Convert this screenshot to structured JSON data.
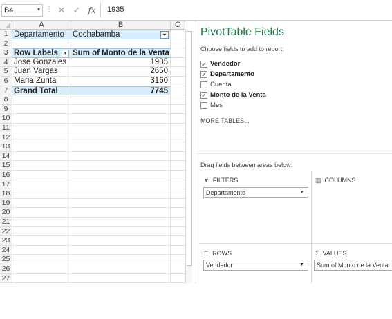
{
  "formula_bar": {
    "name_box": "B4",
    "name_box_arrow": "▾",
    "separator": "⋮",
    "cancel_glyph": "✕",
    "enter_glyph": "✓",
    "fx_label": "fx",
    "value": "1935"
  },
  "sheet": {
    "columns": [
      "A",
      "B",
      "C"
    ],
    "rows": [
      {
        "num": "1",
        "a": "Departamento",
        "b": "Cochabamba"
      },
      {
        "num": "2",
        "a": "",
        "b": ""
      },
      {
        "num": "3",
        "a": "Row Labels",
        "b": "Sum of Monto de la Venta"
      },
      {
        "num": "4",
        "a": "Jose Gonzales",
        "b": "1935"
      },
      {
        "num": "5",
        "a": "Juan Vargas",
        "b": "2650"
      },
      {
        "num": "6",
        "a": "Maria Zurita",
        "b": "3160"
      },
      {
        "num": "7",
        "a": "Grand Total",
        "b": "7745"
      },
      {
        "num": "8"
      },
      {
        "num": "9"
      },
      {
        "num": "10"
      },
      {
        "num": "11"
      },
      {
        "num": "12"
      },
      {
        "num": "13"
      },
      {
        "num": "14"
      },
      {
        "num": "15"
      },
      {
        "num": "16"
      },
      {
        "num": "17"
      },
      {
        "num": "18"
      },
      {
        "num": "19"
      },
      {
        "num": "20"
      },
      {
        "num": "21"
      },
      {
        "num": "22"
      },
      {
        "num": "23"
      },
      {
        "num": "24"
      },
      {
        "num": "25"
      },
      {
        "num": "26"
      },
      {
        "num": "27"
      }
    ]
  },
  "pivot_pane": {
    "title": "PivotTable Fields",
    "subtitle": "Choose fields to add to report:",
    "fields": [
      {
        "label": "Vendedor",
        "checked": true
      },
      {
        "label": "Departamento",
        "checked": true
      },
      {
        "label": "Cuenta",
        "checked": false
      },
      {
        "label": "Monto de la Venta",
        "checked": true
      },
      {
        "label": "Mes",
        "checked": false
      }
    ],
    "more_tables": "MORE TABLES...",
    "drag_hint": "Drag fields between areas below:",
    "areas": {
      "filters": {
        "label": "FILTERS",
        "icon": "filter-icon",
        "chip": "Departamento"
      },
      "columns": {
        "label": "COLUMNS",
        "icon": "columns-icon"
      },
      "rows": {
        "label": "ROWS",
        "icon": "rows-icon",
        "chip": "Vendedor"
      },
      "values": {
        "label": "VALUES",
        "icon": "sigma-icon",
        "chip": "Sum of Monto de la Venta"
      }
    }
  },
  "colors": {
    "pivot_highlight": "#d9eefb",
    "pane_title": "#217346"
  }
}
